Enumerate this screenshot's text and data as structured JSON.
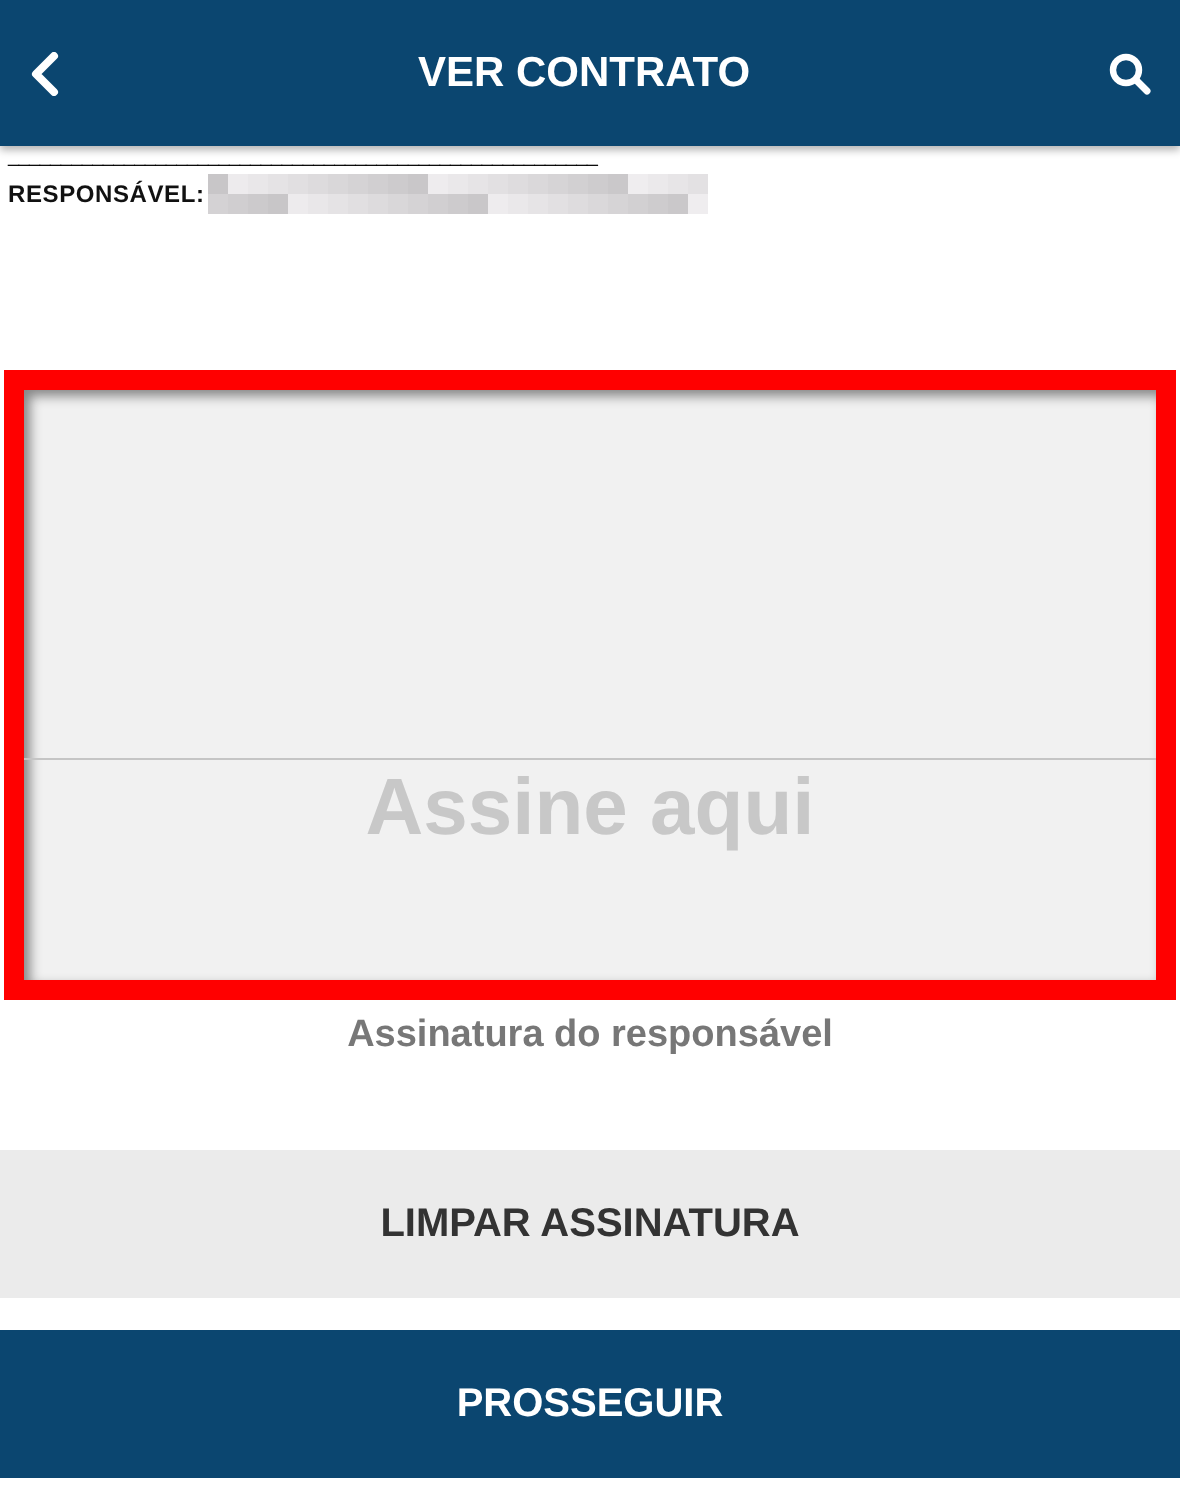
{
  "header": {
    "title": "VER CONTRATO"
  },
  "contract": {
    "signature_line": "________________________________________________________",
    "responsible_label": "RESPONSÁVEL:"
  },
  "signature_pad": {
    "placeholder": "Assine aqui",
    "caption": "Assinatura do responsável"
  },
  "buttons": [
    {
      "label": "LIMPAR ASSINATURA",
      "kind": "secondary"
    },
    {
      "label": "PROSSEGUIR",
      "kind": "primary"
    }
  ]
}
